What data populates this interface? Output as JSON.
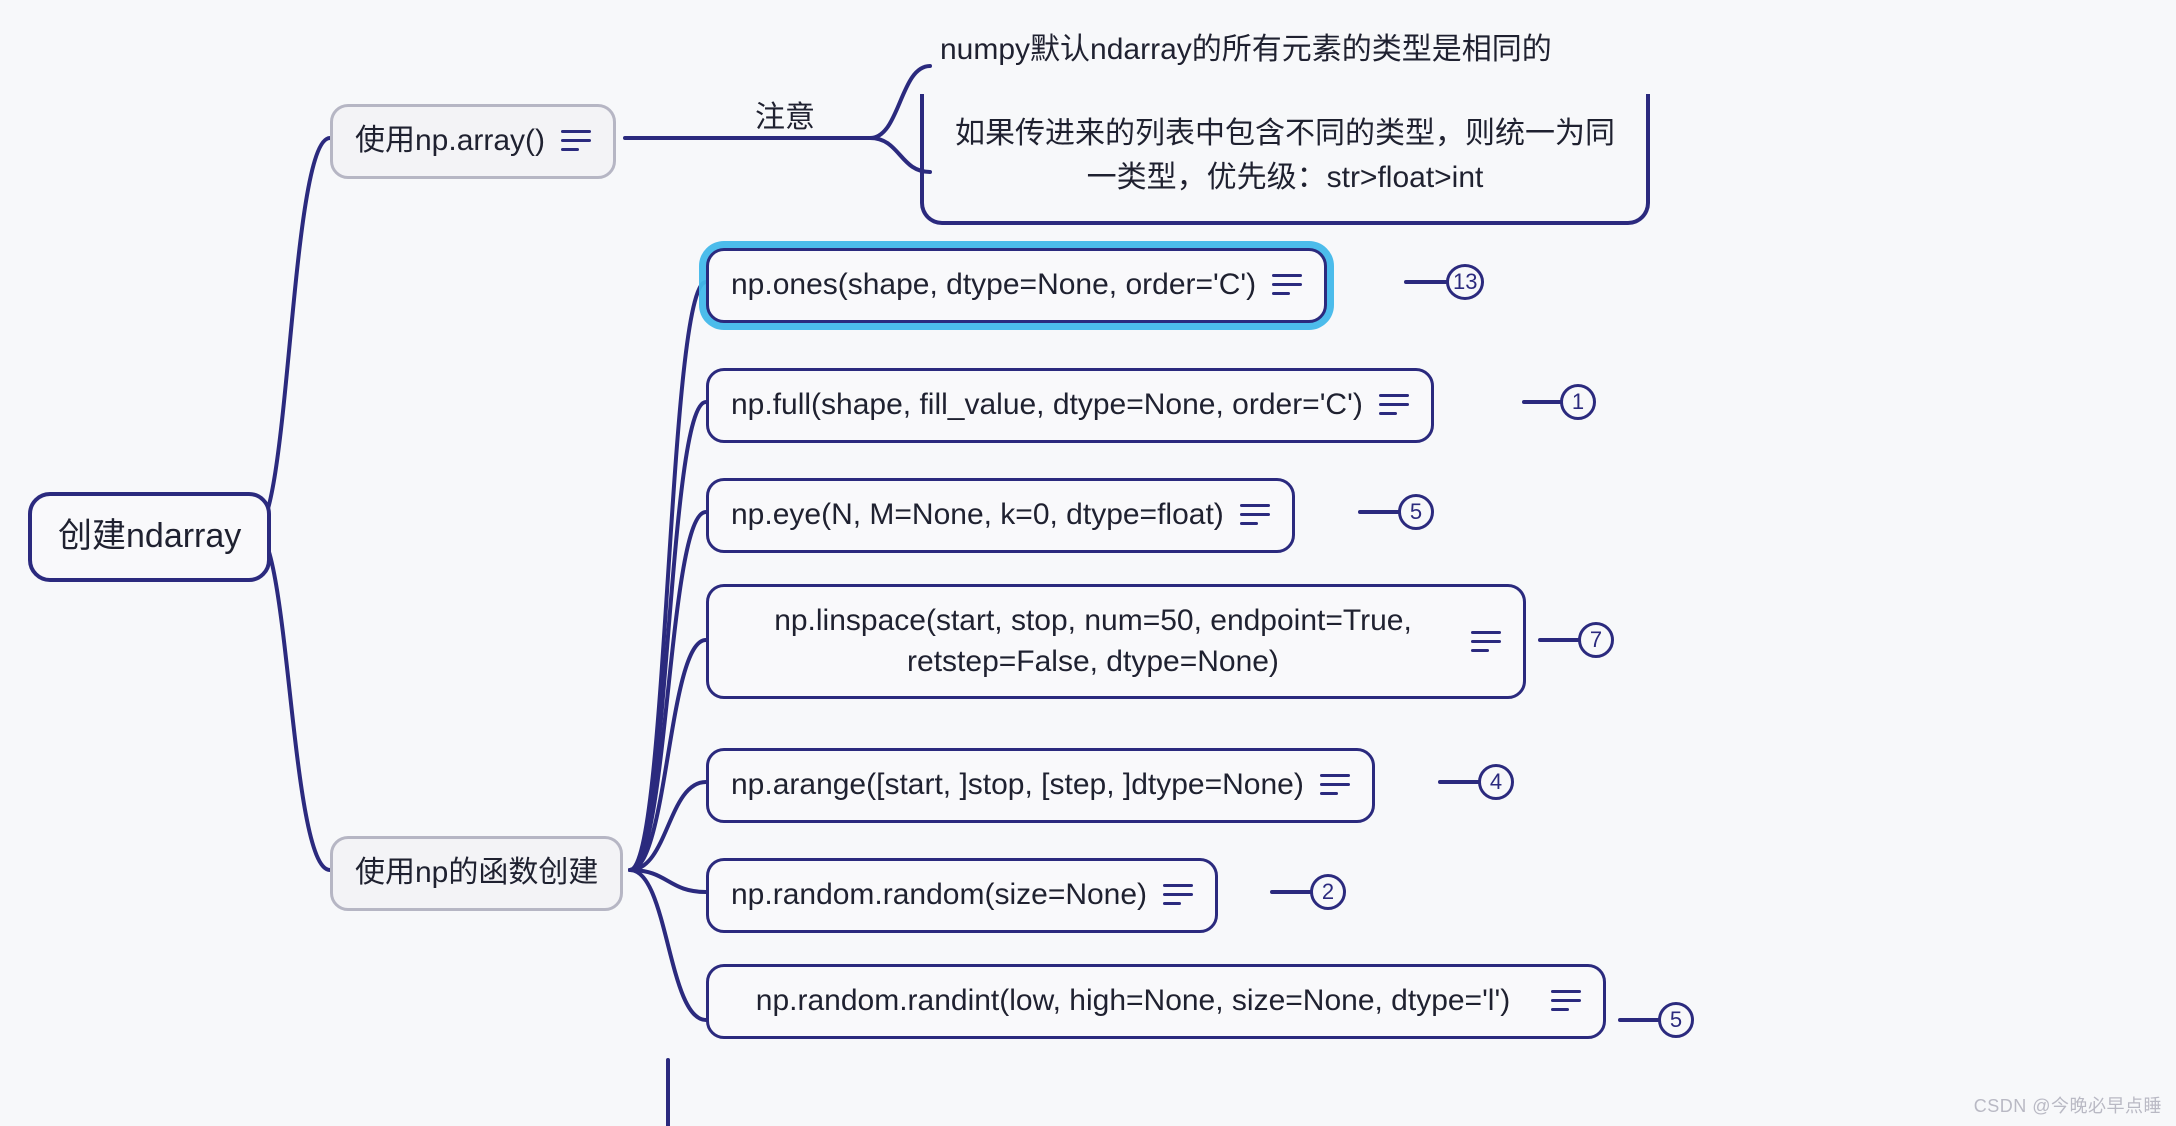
{
  "root": {
    "label": "创建ndarray"
  },
  "branch1": {
    "label": "使用np.array()",
    "edge_label": "注意",
    "note1": "numpy默认ndarray的所有元素的类型是相同的",
    "note2": "如果传进来的列表中包含不同的类型，则统一为同一类型，优先级：str>float>int"
  },
  "branch2": {
    "label": "使用np的函数创建",
    "items": [
      {
        "label": "np.ones(shape, dtype=None, order='C')",
        "badge": "13",
        "selected": true
      },
      {
        "label": "np.full(shape, fill_value, dtype=None, order='C')",
        "badge": "1"
      },
      {
        "label": "np.eye(N, M=None, k=0, dtype=float)",
        "badge": "5"
      },
      {
        "label": "np.linspace(start, stop, num=50, endpoint=True, retstep=False, dtype=None)",
        "badge": "7"
      },
      {
        "label": "np.arange([start, ]stop, [step, ]dtype=None)",
        "badge": "4"
      },
      {
        "label": "np.random.random(size=None)",
        "badge": "2"
      },
      {
        "label": "np.random.randint(low, high=None, size=None, dtype='l')",
        "badge": "5"
      }
    ]
  },
  "watermark": "CSDN @今晚必早点睡"
}
